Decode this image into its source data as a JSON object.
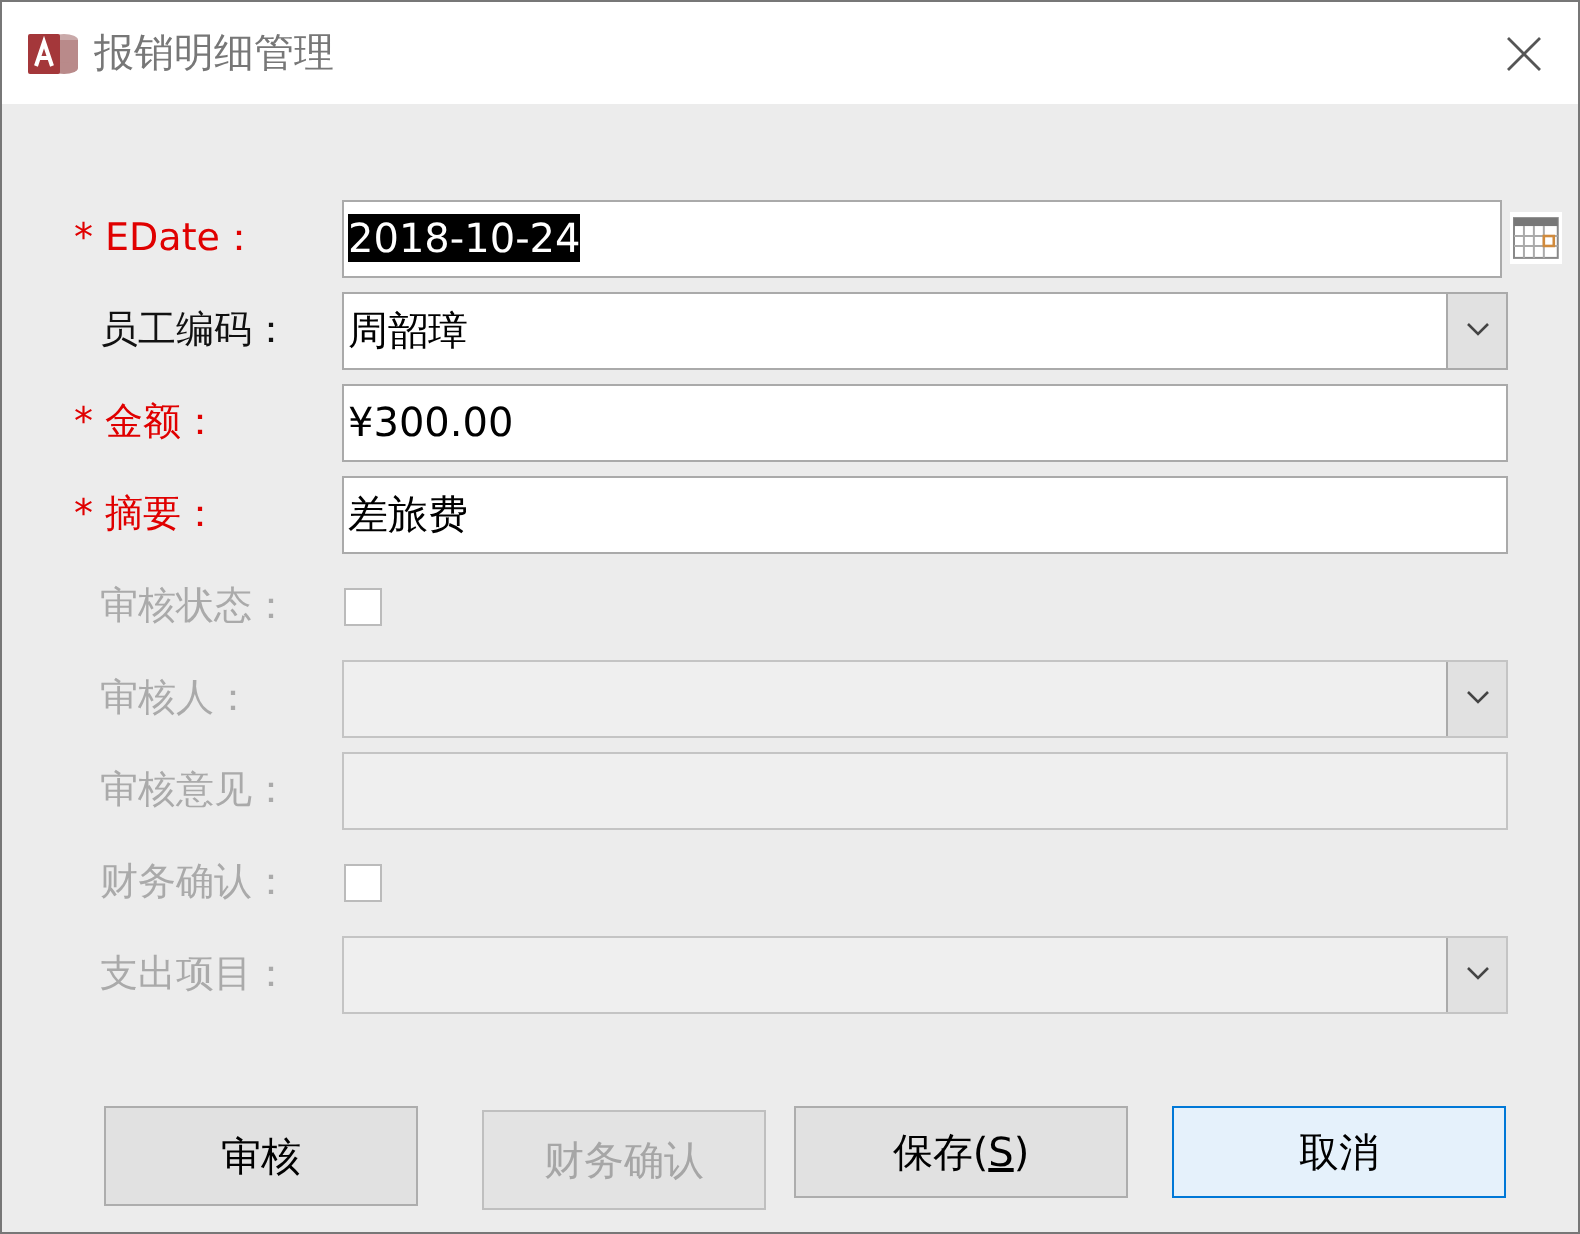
{
  "window": {
    "title": "报销明细管理"
  },
  "fields": [
    {
      "kind": "date",
      "label": "* EDate：",
      "required": true,
      "disabled": false,
      "value": "2018-10-24",
      "selected": true
    },
    {
      "kind": "combo",
      "label": "员工编码：",
      "required": false,
      "disabled": false,
      "value": "周韶璋"
    },
    {
      "kind": "text",
      "label": "* 金额：",
      "required": true,
      "disabled": false,
      "value": "¥300.00"
    },
    {
      "kind": "text",
      "label": "* 摘要：",
      "required": true,
      "disabled": false,
      "value": "差旅费"
    },
    {
      "kind": "checkbox",
      "label": "审核状态：",
      "required": false,
      "disabled": true,
      "checked": false
    },
    {
      "kind": "combo",
      "label": "审核人：",
      "required": false,
      "disabled": true
    },
    {
      "kind": "text",
      "label": "审核意见：",
      "required": false,
      "disabled": true
    },
    {
      "kind": "checkbox",
      "label": "财务确认：",
      "required": false,
      "disabled": true,
      "checked": false
    },
    {
      "kind": "combo",
      "label": "支出项目：",
      "required": false,
      "disabled": true
    }
  ],
  "buttons": [
    {
      "label": "审核",
      "disabled": false,
      "focused": false
    },
    {
      "label": "财务确认",
      "disabled": true,
      "focused": false
    },
    {
      "label_before": "保存(",
      "mnemonic": "S",
      "label_after": ")",
      "disabled": false,
      "focused": false
    },
    {
      "label": "取消",
      "disabled": false,
      "focused": true
    }
  ]
}
